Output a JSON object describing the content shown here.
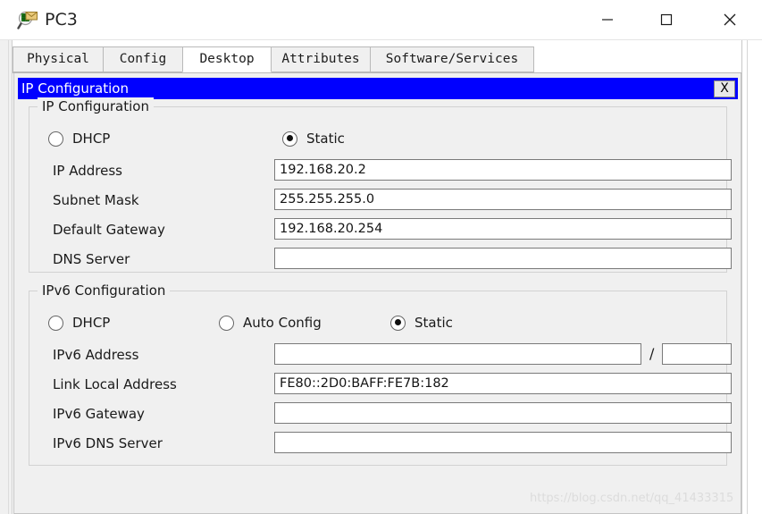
{
  "window": {
    "title": "PC3",
    "icon": "packet-tracer-device-icon",
    "controls": {
      "minimize": "—",
      "maximize": "□",
      "close": "✕"
    }
  },
  "tabs": [
    {
      "label": "Physical",
      "active": false
    },
    {
      "label": "Config",
      "active": false
    },
    {
      "label": "Desktop",
      "active": true
    },
    {
      "label": "Attributes",
      "active": false
    },
    {
      "label": "Software/Services",
      "active": false
    }
  ],
  "dialog": {
    "title": "IP Configuration",
    "close_label": "X",
    "titlebar_color": "#0000ff",
    "titlebar_text_color": "#ffffff"
  },
  "ipv4": {
    "group_title": "IP Configuration",
    "modes": [
      {
        "label": "DHCP",
        "selected": false
      },
      {
        "label": "Static",
        "selected": true
      }
    ],
    "fields": [
      {
        "label": "IP Address",
        "value": "192.168.20.2"
      },
      {
        "label": "Subnet Mask",
        "value": "255.255.255.0"
      },
      {
        "label": "Default Gateway",
        "value": "192.168.20.254"
      },
      {
        "label": "DNS Server",
        "value": ""
      }
    ]
  },
  "ipv6": {
    "group_title": "IPv6 Configuration",
    "modes": [
      {
        "label": "DHCP",
        "selected": false
      },
      {
        "label": "Auto Config",
        "selected": false
      },
      {
        "label": "Static",
        "selected": true
      }
    ],
    "address": {
      "label": "IPv6 Address",
      "value": "",
      "prefix": "",
      "separator": "/"
    },
    "fields": [
      {
        "label": "Link Local Address",
        "value": "FE80::2D0:BAFF:FE7B:182"
      },
      {
        "label": "IPv6 Gateway",
        "value": ""
      },
      {
        "label": "IPv6 DNS Server",
        "value": ""
      }
    ]
  },
  "watermark": "https://blog.csdn.net/qq_41433315"
}
